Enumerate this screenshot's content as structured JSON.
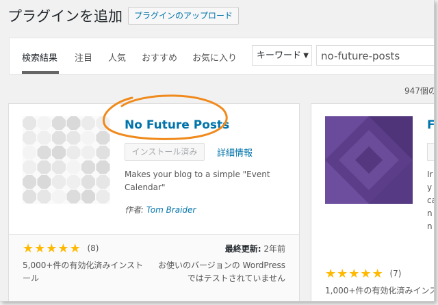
{
  "header": {
    "title": "プラグインを追加",
    "upload_button": "プラグインのアップロード"
  },
  "filter": {
    "tabs": [
      {
        "label": "検索結果",
        "active": true
      },
      {
        "label": "注目"
      },
      {
        "label": "人気"
      },
      {
        "label": "おすすめ"
      },
      {
        "label": "お気に入り"
      }
    ],
    "search_type": "キーワード",
    "search_value": "no-future-posts"
  },
  "result_count": "947個の",
  "plugin1": {
    "name": "No Future Posts",
    "install_label": "インストール済み",
    "details_label": "詳細情報",
    "description": "Makes your blog to a simple \"Event Calendar\"",
    "author_label": "作者:",
    "author": "Tom Braider",
    "rating_stars": 5,
    "rating_count": "(8)",
    "installs": "5,000+件の有効化済みインストール",
    "updated_label": "最終更新:",
    "updated_value": "2年前",
    "compat": "お使いのバージョンの WordPress ではテストされていません"
  },
  "plugin2": {
    "name_partial": "F",
    "desc_partial": "Ir\ny\nca\nn\nn",
    "rating_count": "(7)",
    "installs": "1,000+件の有効化済みインスト"
  },
  "colors": {
    "link": "#0073aa",
    "star": "#ffb900",
    "annotation": "#f08a1c",
    "thumb2": "#5c3d8a"
  }
}
